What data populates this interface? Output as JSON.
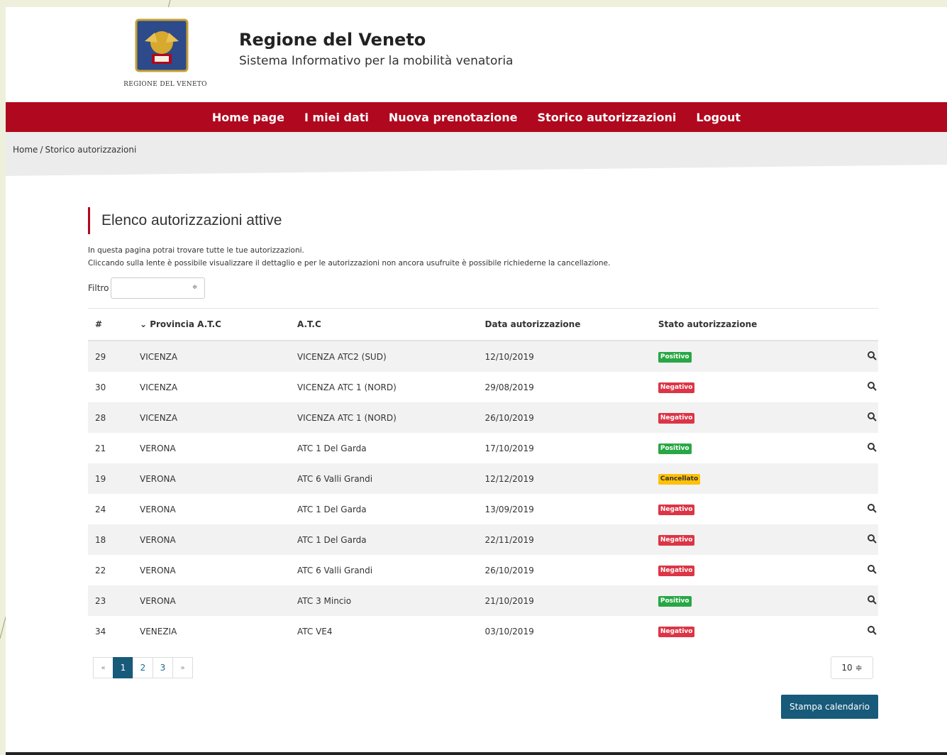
{
  "header": {
    "logo_caption": "REGIONE DEL VENETO",
    "title": "Regione del Veneto",
    "subtitle": "Sistema Informativo per la mobilità venatoria"
  },
  "nav": {
    "items": [
      {
        "label": "Home page"
      },
      {
        "label": "I miei dati"
      },
      {
        "label": "Nuova prenotazione"
      },
      {
        "label": "Storico autorizzazioni"
      },
      {
        "label": "Logout"
      }
    ]
  },
  "breadcrumb": {
    "home": "Home",
    "separator": "/",
    "current": "Storico autorizzazioni"
  },
  "main": {
    "section_title": "Elenco autorizzazioni attive",
    "intro_line1": "In questa pagina potrai trovare tutte le tue autorizzazioni.",
    "intro_line2": "Cliccando sulla lente è possibile visualizzare il dettaglio e per le autorizzazioni non ancora usufruite è possibile richiederne la cancellazione.",
    "filter_label": "Filtro",
    "filter_value": "",
    "table": {
      "columns": [
        "#",
        "Provincia A.T.C",
        "A.T.C",
        "Data autorizzazione",
        "Stato autorizzazione"
      ],
      "sort_icon": "chevron-down-icon",
      "rows": [
        {
          "id": "29",
          "provincia": "VICENZA",
          "atc": "VICENZA ATC2 (SUD)",
          "data": "12/10/2019",
          "stato": "Positivo",
          "status_type": "pos",
          "has_lens": true
        },
        {
          "id": "30",
          "provincia": "VICENZA",
          "atc": "VICENZA ATC 1 (NORD)",
          "data": "29/08/2019",
          "stato": "Negativo",
          "status_type": "neg",
          "has_lens": true
        },
        {
          "id": "28",
          "provincia": "VICENZA",
          "atc": "VICENZA ATC 1 (NORD)",
          "data": "26/10/2019",
          "stato": "Negativo",
          "status_type": "neg",
          "has_lens": true
        },
        {
          "id": "21",
          "provincia": "VERONA",
          "atc": "ATC 1 Del Garda",
          "data": "17/10/2019",
          "stato": "Positivo",
          "status_type": "pos",
          "has_lens": true
        },
        {
          "id": "19",
          "provincia": "VERONA",
          "atc": "ATC 6 Valli Grandi",
          "data": "12/12/2019",
          "stato": "Cancellato",
          "status_type": "can",
          "has_lens": false
        },
        {
          "id": "24",
          "provincia": "VERONA",
          "atc": "ATC 1 Del Garda",
          "data": "13/09/2019",
          "stato": "Negativo",
          "status_type": "neg",
          "has_lens": true
        },
        {
          "id": "18",
          "provincia": "VERONA",
          "atc": "ATC 1 Del Garda",
          "data": "22/11/2019",
          "stato": "Negativo",
          "status_type": "neg",
          "has_lens": true
        },
        {
          "id": "22",
          "provincia": "VERONA",
          "atc": "ATC 6 Valli Grandi",
          "data": "26/10/2019",
          "stato": "Negativo",
          "status_type": "neg",
          "has_lens": true
        },
        {
          "id": "23",
          "provincia": "VERONA",
          "atc": "ATC 3 Mincio",
          "data": "21/10/2019",
          "stato": "Positivo",
          "status_type": "pos",
          "has_lens": true
        },
        {
          "id": "34",
          "provincia": "VENEZIA",
          "atc": "ATC VE4",
          "data": "03/10/2019",
          "stato": "Negativo",
          "status_type": "neg",
          "has_lens": true
        }
      ]
    },
    "pagination": {
      "prev": "«",
      "pages": [
        "1",
        "2",
        "3"
      ],
      "active_page": "1",
      "next": "»"
    },
    "page_size": "10 ≑",
    "print_button": "Stampa calendario"
  },
  "colors": {
    "navbar": "#b0081e",
    "primary_button": "#175a7a",
    "badge_positive": "#28a745",
    "badge_negative": "#dc3545",
    "badge_cancelled": "#ffc107"
  }
}
